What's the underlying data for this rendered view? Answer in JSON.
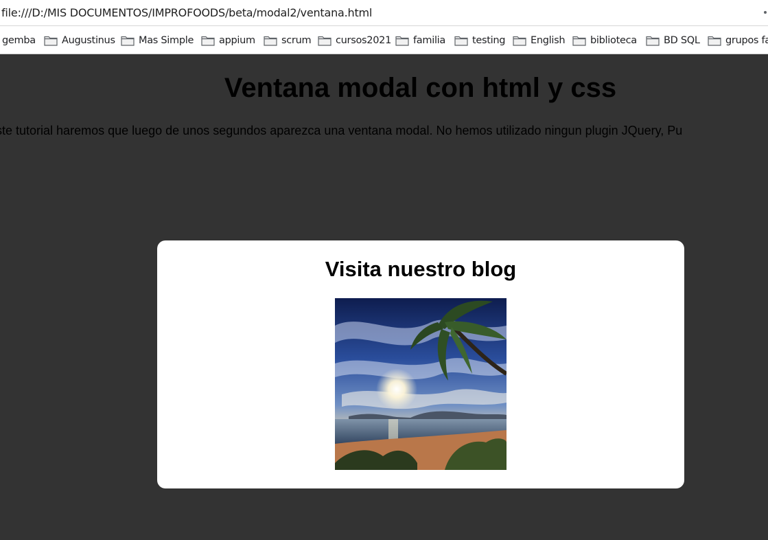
{
  "browser": {
    "url": "file:///D:/MIS DOCUMENTOS/IMPROFOODS/beta/modal2/ventana.html",
    "bookmarks": [
      "gemba",
      "Augustinus",
      "Mas Simple",
      "appium",
      "scrum",
      "cursos2021",
      "familia",
      "testing",
      "English",
      "biblioteca",
      "BD SQL",
      "grupos fa"
    ],
    "folder_icon": "folder-icon"
  },
  "page": {
    "title": "Ventana modal con html y css",
    "paragraph": "este tutorial haremos que luego de unos segundos aparezca una ventana modal. No hemos utilizado ningun plugin JQuery, Pu"
  },
  "modal": {
    "title": "Visita nuestro blog",
    "image_description": "palm-beach-sunset-image"
  },
  "colors": {
    "page_background": "#333333",
    "modal_background": "#ffffff",
    "text": "#000000"
  }
}
